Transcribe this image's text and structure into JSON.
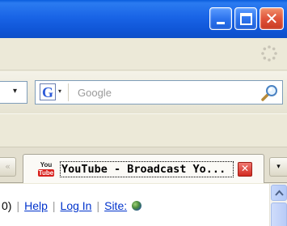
{
  "titlebar": {
    "minimize_icon": "minimize-icon",
    "maximize_icon": "maximize-icon",
    "close_icon": "close-icon",
    "close_glyph": "✕",
    "accent_color": "#1964e6",
    "close_color": "#e0543a"
  },
  "menubar": {
    "throbber_icon": "loading-throbber-icon"
  },
  "navbar": {
    "url_dropdown_arrow": "▾",
    "search": {
      "engine_letter": "G",
      "engine_icon": "google-engine-icon",
      "engine_arrow": "▾",
      "placeholder": "Google",
      "go_icon": "magnifier-icon"
    }
  },
  "tabs": {
    "scroll_left_glyph": "«",
    "active": {
      "favicon_top": "You",
      "favicon_bottom": "Tube",
      "title": "YouTube - Broadcast Yo...",
      "close_glyph": "✕"
    },
    "list_glyph": "▾"
  },
  "page": {
    "partial_text": "0)",
    "help_link": "Help",
    "login_link": "Log In",
    "site_link": "Site:",
    "separator": "|",
    "link_color": "#0033cc"
  }
}
